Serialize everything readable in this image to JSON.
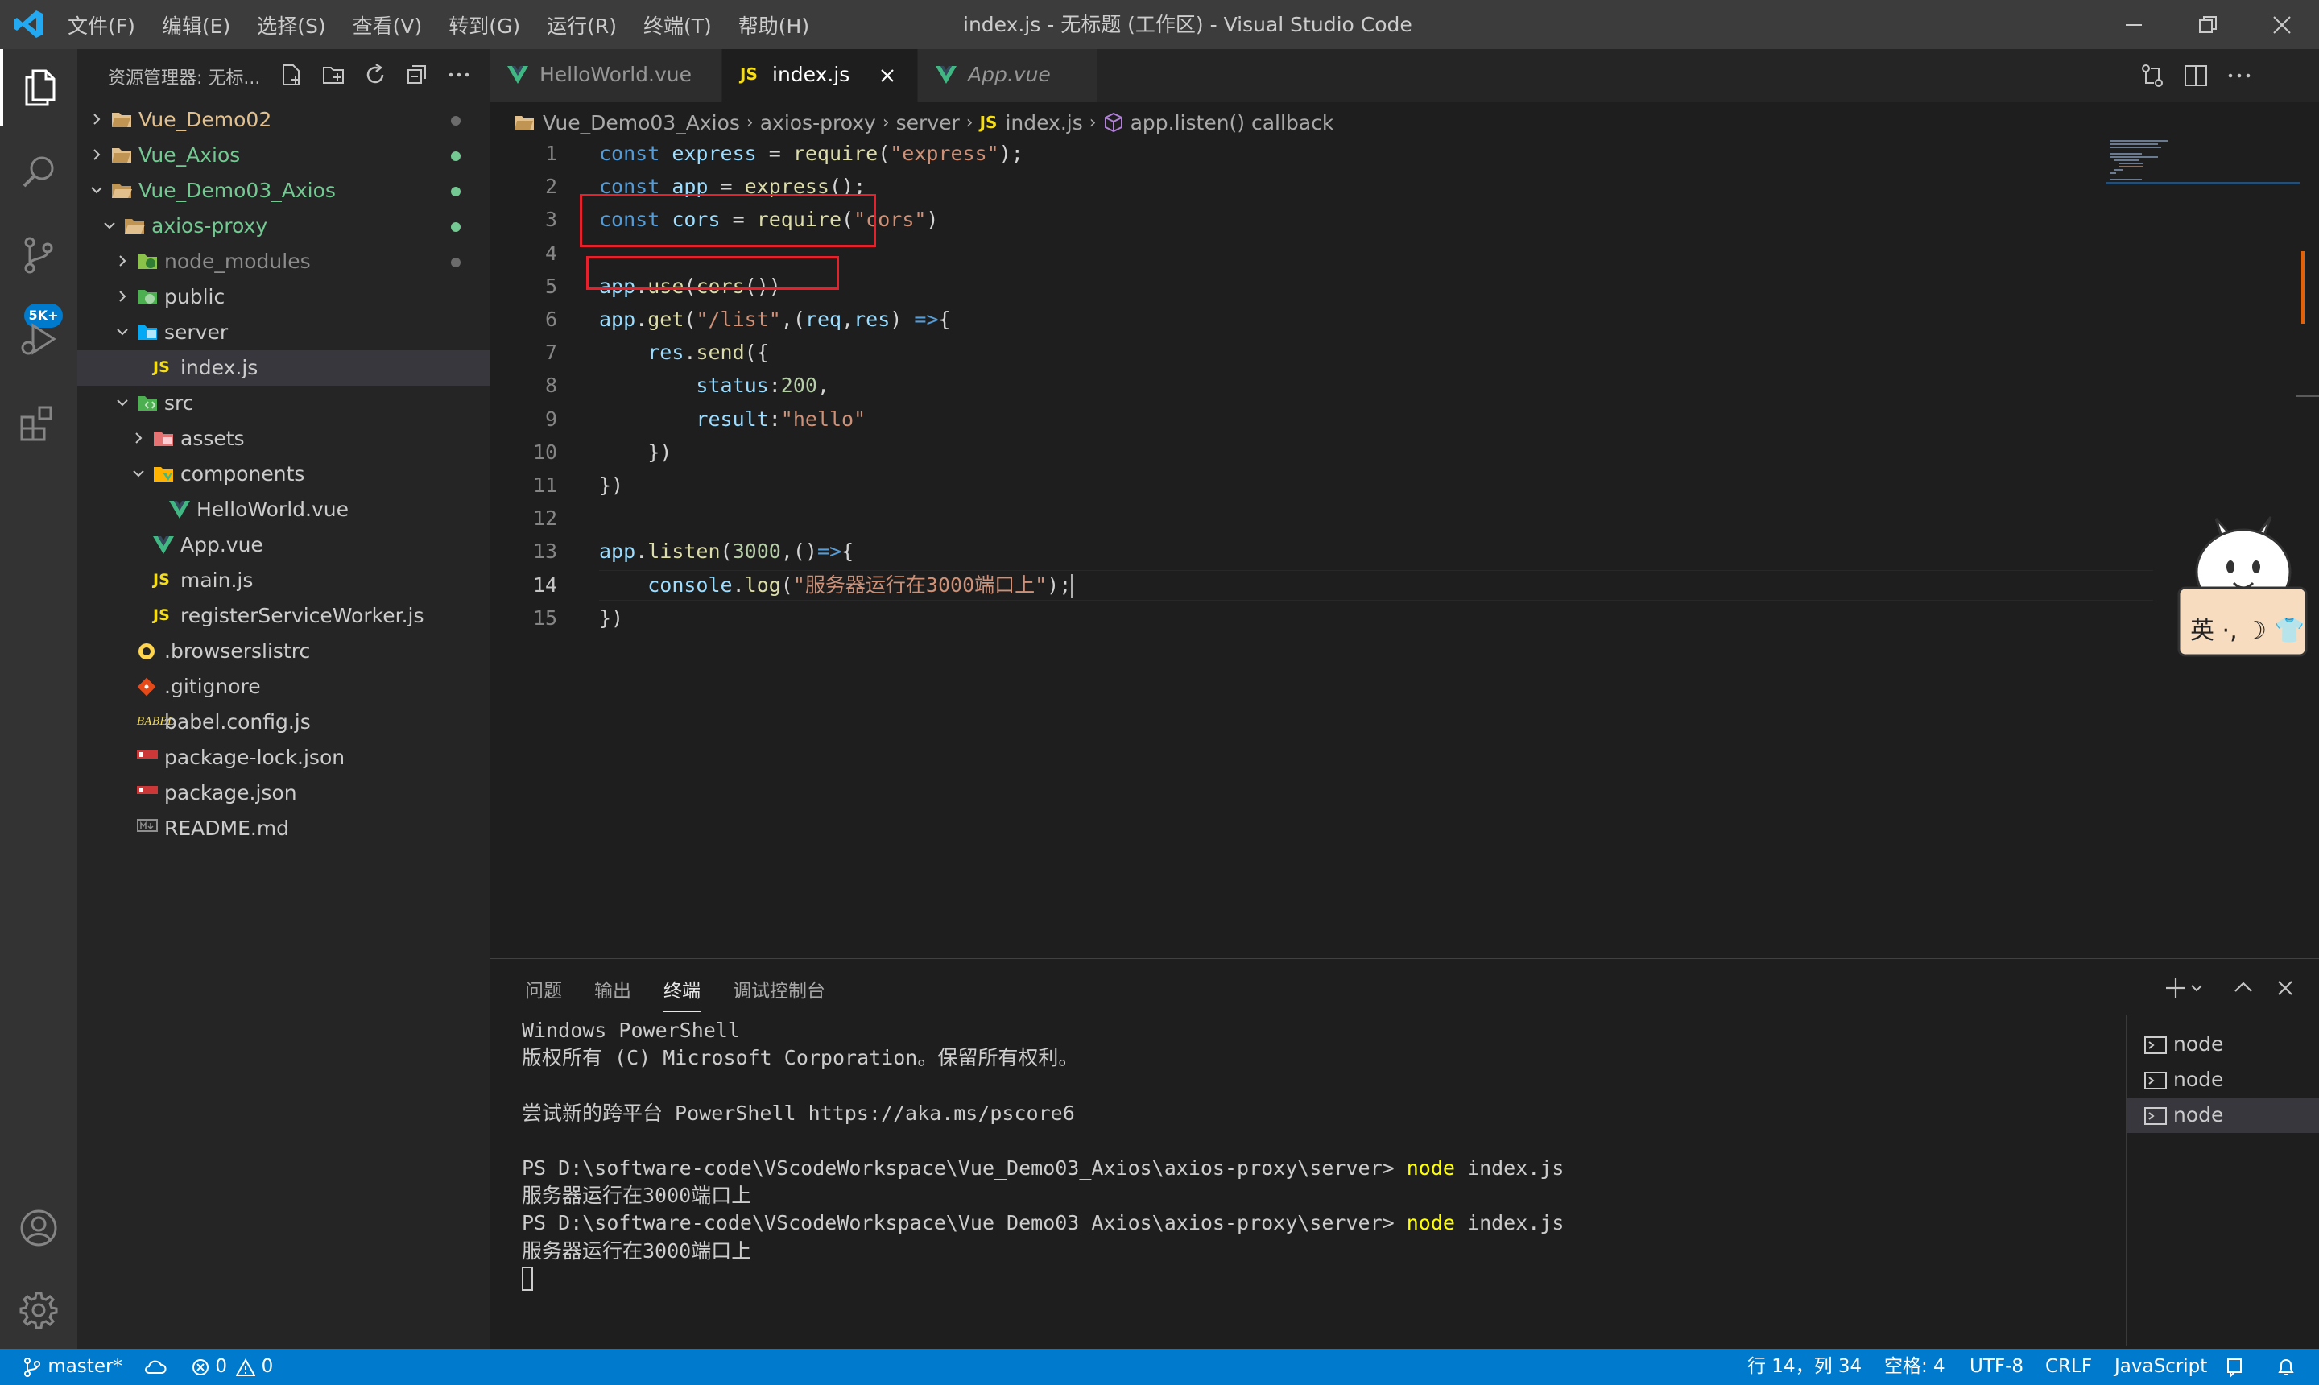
{
  "window": {
    "title": "index.js - 无标题 (工作区) - Visual Studio Code",
    "menu": [
      "文件(F)",
      "编辑(E)",
      "选择(S)",
      "查看(V)",
      "转到(G)",
      "运行(R)",
      "终端(T)",
      "帮助(H)"
    ]
  },
  "activity_bar": {
    "badge": "5K+",
    "icons": [
      "explorer-icon",
      "search-icon",
      "source-control-icon",
      "run-debug-icon",
      "extensions-icon",
      "account-icon",
      "settings-gear-icon"
    ]
  },
  "sidebar": {
    "title": "资源管理器: 无标...",
    "tree": [
      {
        "label": "Vue_Demo02",
        "depth": 0,
        "chevron": "right",
        "icon": "folder-icon",
        "color": "#e2c08d",
        "dot": "#6b6b6b"
      },
      {
        "label": "Vue_Axios",
        "depth": 0,
        "chevron": "right",
        "icon": "folder-icon",
        "color": "#73c991",
        "dot": "#73c991"
      },
      {
        "label": "Vue_Demo03_Axios",
        "depth": 0,
        "chevron": "down",
        "icon": "folder-open-icon",
        "color": "#73c991",
        "dot": "#73c991"
      },
      {
        "label": "axios-proxy",
        "depth": 1,
        "chevron": "down",
        "icon": "folder-open-icon",
        "color": "#73c991",
        "dot": "#73c991"
      },
      {
        "label": "node_modules",
        "depth": 2,
        "chevron": "right",
        "icon": "node-folder-icon",
        "color": "#8c8c8c",
        "dot": "#6b6b6b"
      },
      {
        "label": "public",
        "depth": 2,
        "chevron": "right",
        "icon": "public-folder-icon",
        "color": "#cccccc",
        "dot": ""
      },
      {
        "label": "server",
        "depth": 2,
        "chevron": "down",
        "icon": "server-folder-icon",
        "color": "#cccccc",
        "dot": ""
      },
      {
        "label": "index.js",
        "depth": 3,
        "chevron": "",
        "icon": "js-file-icon",
        "color": "#cccccc",
        "dot": "",
        "selected": true
      },
      {
        "label": "src",
        "depth": 2,
        "chevron": "down",
        "icon": "src-folder-icon",
        "color": "#cccccc",
        "dot": ""
      },
      {
        "label": "assets",
        "depth": 3,
        "chevron": "right",
        "icon": "assets-folder-icon",
        "color": "#cccccc",
        "dot": ""
      },
      {
        "label": "components",
        "depth": 3,
        "chevron": "down",
        "icon": "components-folder-icon",
        "color": "#cccccc",
        "dot": ""
      },
      {
        "label": "HelloWorld.vue",
        "depth": 4,
        "chevron": "",
        "icon": "vue-file-icon",
        "color": "#cccccc",
        "dot": ""
      },
      {
        "label": "App.vue",
        "depth": 3,
        "chevron": "",
        "icon": "vue-file-icon",
        "color": "#cccccc",
        "dot": ""
      },
      {
        "label": "main.js",
        "depth": 3,
        "chevron": "",
        "icon": "js-file-icon",
        "color": "#cccccc",
        "dot": ""
      },
      {
        "label": "registerServiceWorker.js",
        "depth": 3,
        "chevron": "",
        "icon": "js-file-icon",
        "color": "#cccccc",
        "dot": ""
      },
      {
        "label": ".browserslistrc",
        "depth": 2,
        "chevron": "",
        "icon": "browserslist-icon",
        "color": "#cccccc",
        "dot": ""
      },
      {
        "label": ".gitignore",
        "depth": 2,
        "chevron": "",
        "icon": "git-icon",
        "color": "#cccccc",
        "dot": ""
      },
      {
        "label": "babel.config.js",
        "depth": 2,
        "chevron": "",
        "icon": "babel-icon",
        "color": "#cccccc",
        "dot": ""
      },
      {
        "label": "package-lock.json",
        "depth": 2,
        "chevron": "",
        "icon": "npm-icon",
        "color": "#cccccc",
        "dot": ""
      },
      {
        "label": "package.json",
        "depth": 2,
        "chevron": "",
        "icon": "npm-icon",
        "color": "#cccccc",
        "dot": ""
      },
      {
        "label": "README.md",
        "depth": 2,
        "chevron": "",
        "icon": "markdown-icon",
        "color": "#cccccc",
        "dot": ""
      }
    ]
  },
  "tabs": [
    {
      "label": "HelloWorld.vue",
      "icon": "vue-file-icon",
      "active": false
    },
    {
      "label": "index.js",
      "icon": "js-file-icon",
      "active": true
    },
    {
      "label": "App.vue",
      "icon": "vue-file-icon",
      "active": false
    }
  ],
  "breadcrumbs": [
    "Vue_Demo03_Axios",
    "axios-proxy",
    "server",
    "index.js",
    "app.listen() callback"
  ],
  "editor": {
    "current_line": 14,
    "lines": [
      {
        "no": "1",
        "tokens": [
          [
            "k",
            "const "
          ],
          [
            "v",
            "express"
          ],
          [
            "p",
            " = "
          ],
          [
            "f",
            "require"
          ],
          [
            "p",
            "("
          ],
          [
            "s",
            "\"express\""
          ],
          [
            "p",
            ");"
          ]
        ]
      },
      {
        "no": "2",
        "tokens": [
          [
            "k",
            "const "
          ],
          [
            "v",
            "app"
          ],
          [
            "p",
            " = "
          ],
          [
            "f",
            "express"
          ],
          [
            "p",
            "();"
          ]
        ]
      },
      {
        "no": "3",
        "tokens": [
          [
            "k",
            "const "
          ],
          [
            "v",
            "cors"
          ],
          [
            "p",
            " = "
          ],
          [
            "f",
            "require"
          ],
          [
            "p",
            "("
          ],
          [
            "s",
            "\"cors\""
          ],
          [
            "p",
            ")"
          ]
        ]
      },
      {
        "no": "4",
        "tokens": []
      },
      {
        "no": "5",
        "tokens": [
          [
            "v",
            "app"
          ],
          [
            "p",
            "."
          ],
          [
            "f",
            "use"
          ],
          [
            "p",
            "("
          ],
          [
            "f",
            "cors"
          ],
          [
            "p",
            "())"
          ]
        ]
      },
      {
        "no": "6",
        "tokens": [
          [
            "v",
            "app"
          ],
          [
            "p",
            "."
          ],
          [
            "f",
            "get"
          ],
          [
            "p",
            "("
          ],
          [
            "s",
            "\"/list\""
          ],
          [
            "p",
            ",("
          ],
          [
            "v",
            "req"
          ],
          [
            "p",
            ","
          ],
          [
            "v",
            "res"
          ],
          [
            "p",
            ") "
          ],
          [
            "k",
            "=>"
          ],
          [
            "p",
            "{"
          ]
        ]
      },
      {
        "no": "7",
        "tokens": [
          [
            "p",
            "    "
          ],
          [
            "v",
            "res"
          ],
          [
            "p",
            "."
          ],
          [
            "f",
            "send"
          ],
          [
            "p",
            "({"
          ]
        ]
      },
      {
        "no": "8",
        "tokens": [
          [
            "p",
            "        "
          ],
          [
            "v",
            "status"
          ],
          [
            "p",
            ":"
          ],
          [
            "n",
            "200"
          ],
          [
            "p",
            ","
          ]
        ]
      },
      {
        "no": "9",
        "tokens": [
          [
            "p",
            "        "
          ],
          [
            "v",
            "result"
          ],
          [
            "p",
            ":"
          ],
          [
            "s",
            "\"hello\""
          ]
        ]
      },
      {
        "no": "10",
        "tokens": [
          [
            "p",
            "    })"
          ]
        ]
      },
      {
        "no": "11",
        "tokens": [
          [
            "p",
            "})"
          ]
        ]
      },
      {
        "no": "12",
        "tokens": []
      },
      {
        "no": "13",
        "tokens": [
          [
            "v",
            "app"
          ],
          [
            "p",
            "."
          ],
          [
            "f",
            "listen"
          ],
          [
            "p",
            "("
          ],
          [
            "n",
            "3000"
          ],
          [
            "p",
            ",()"
          ],
          [
            "k",
            "=>"
          ],
          [
            "p",
            "{"
          ]
        ]
      },
      {
        "no": "14",
        "tokens": [
          [
            "p",
            "    "
          ],
          [
            "v",
            "console"
          ],
          [
            "p",
            "."
          ],
          [
            "f",
            "log"
          ],
          [
            "p",
            "("
          ],
          [
            "s",
            "\"服务器运行在3000端口上\""
          ],
          [
            "p",
            ");"
          ]
        ]
      },
      {
        "no": "15",
        "tokens": [
          [
            "p",
            "})"
          ]
        ]
      }
    ]
  },
  "panel": {
    "tabs": [
      "问题",
      "输出",
      "终端",
      "调试控制台"
    ],
    "active_tab": "终端",
    "terminal_lines": [
      {
        "text": "Windows PowerShell"
      },
      {
        "text": "版权所有 (C) Microsoft Corporation。保留所有权利。"
      },
      {
        "text": ""
      },
      {
        "text": "尝试新的跨平台 PowerShell https://aka.ms/pscore6"
      },
      {
        "text": ""
      },
      {
        "prompt": "PS D:\\software-code\\VScodeWorkspace\\Vue_Demo03_Axios\\axios-proxy\\server> ",
        "cmd": "node",
        "args": " index.js"
      },
      {
        "text": "服务器运行在3000端口上"
      },
      {
        "prompt": "PS D:\\software-code\\VScodeWorkspace\\Vue_Demo03_Axios\\axios-proxy\\server> ",
        "cmd": "node",
        "args": " index.js"
      },
      {
        "text": "服务器运行在3000端口上"
      }
    ],
    "sessions": [
      "node",
      "node",
      "node"
    ],
    "selected_session": 2
  },
  "statusbar": {
    "branch": "master*",
    "errors": "0",
    "warnings": "0",
    "position": "行 14，列 34",
    "spaces": "空格: 4",
    "encoding": "UTF-8",
    "eol": "CRLF",
    "language": "JavaScript"
  },
  "ime": {
    "label": "英 ·, ☽ 👕"
  },
  "colors": {
    "accent": "#007acc",
    "highlight_box": "#e8202b",
    "git_added": "#73c991",
    "git_modified": "#e2c08d"
  }
}
